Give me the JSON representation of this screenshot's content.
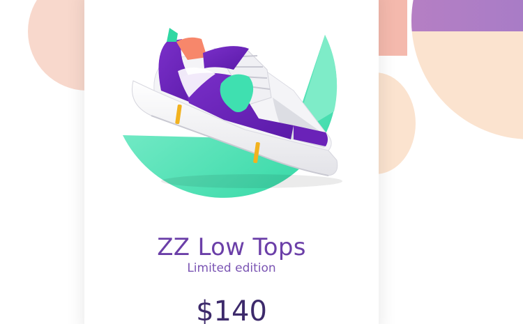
{
  "product": {
    "name": "ZZ Low Tops",
    "subtitle": "Limited edition",
    "price": "$140"
  },
  "colors": {
    "accent_purple": "#6b3fa8",
    "mint": "#3fe0b0",
    "peach": "#fbe3cf",
    "coral": "#f4b9ad"
  }
}
